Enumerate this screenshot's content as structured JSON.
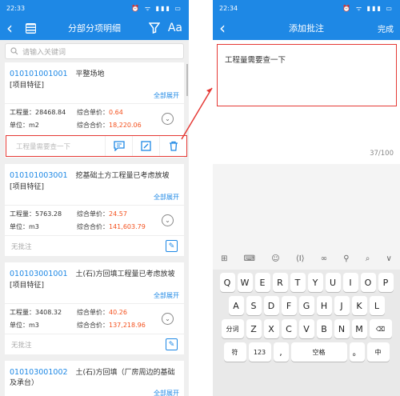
{
  "left": {
    "status_time": "22:33",
    "status_icons": "⏰ ᯤ ▮▮▮ ▭",
    "title": "分部分项明细",
    "aa": "Aa",
    "search_placeholder": "请输入关键词",
    "cards": [
      {
        "code": "010101001001",
        "name": "平整场地",
        "feature": "[项目特征]",
        "expand": "全部展开",
        "qty_label": "工程量：",
        "qty": "28468.84",
        "unit_price_label": "综合单价：",
        "unit_price": "0.64",
        "unit_label": "单位：",
        "unit": "m2",
        "total_label": "综合合价：",
        "total": "18,220.06"
      },
      {
        "code": "010101003001",
        "name": "挖基础土方工程量已考虑放坡",
        "feature": "[项目特征]",
        "expand": "全部展开",
        "qty_label": "工程量：",
        "qty": "5763.28",
        "unit_price_label": "综合单价：",
        "unit_price": "24.57",
        "unit_label": "单位：",
        "unit": "m3",
        "total_label": "综合合价：",
        "total": "141,603.79",
        "annot": "无批注"
      },
      {
        "code": "010103001001",
        "name": "土(石)方回填工程量已考虑放坡",
        "feature": "[项目特征]",
        "expand": "全部展开",
        "qty_label": "工程量：",
        "qty": "3408.32",
        "unit_price_label": "综合单价：",
        "unit_price": "40.26",
        "unit_label": "单位：",
        "unit": "m3",
        "total_label": "综合合价：",
        "total": "137,218.96",
        "annot": "无批注"
      },
      {
        "code": "010103001002",
        "name": "土(石)方回填（厂房周边的基础及承台）",
        "expand": "全部展开"
      }
    ],
    "note_placeholder": "工程量需要查一下"
  },
  "right": {
    "status_time": "22:34",
    "status_icons": "⏰ ᯤ ▮▮▮ ▭",
    "title": "添加批注",
    "done": "完成",
    "note_text": "工程量需要查一下",
    "counter": "37/100",
    "toolbar": [
      "⊞",
      "⌨",
      "☺",
      "⟨I⟩",
      "∞",
      "⚲",
      "⌕",
      "∨"
    ],
    "row1": [
      "Q",
      "W",
      "E",
      "R",
      "T",
      "Y",
      "U",
      "I",
      "O",
      "P"
    ],
    "row2": [
      "A",
      "S",
      "D",
      "F",
      "G",
      "H",
      "J",
      "K",
      "L"
    ],
    "row3": [
      "分词",
      "Z",
      "X",
      "C",
      "V",
      "B",
      "N",
      "M",
      "⌫"
    ],
    "row4": [
      "符",
      "123",
      ",",
      "空格",
      "。",
      "中"
    ]
  },
  "colors": {
    "accent": "#1e88e5",
    "price": "#f4511e",
    "highlight": "#e53935"
  }
}
